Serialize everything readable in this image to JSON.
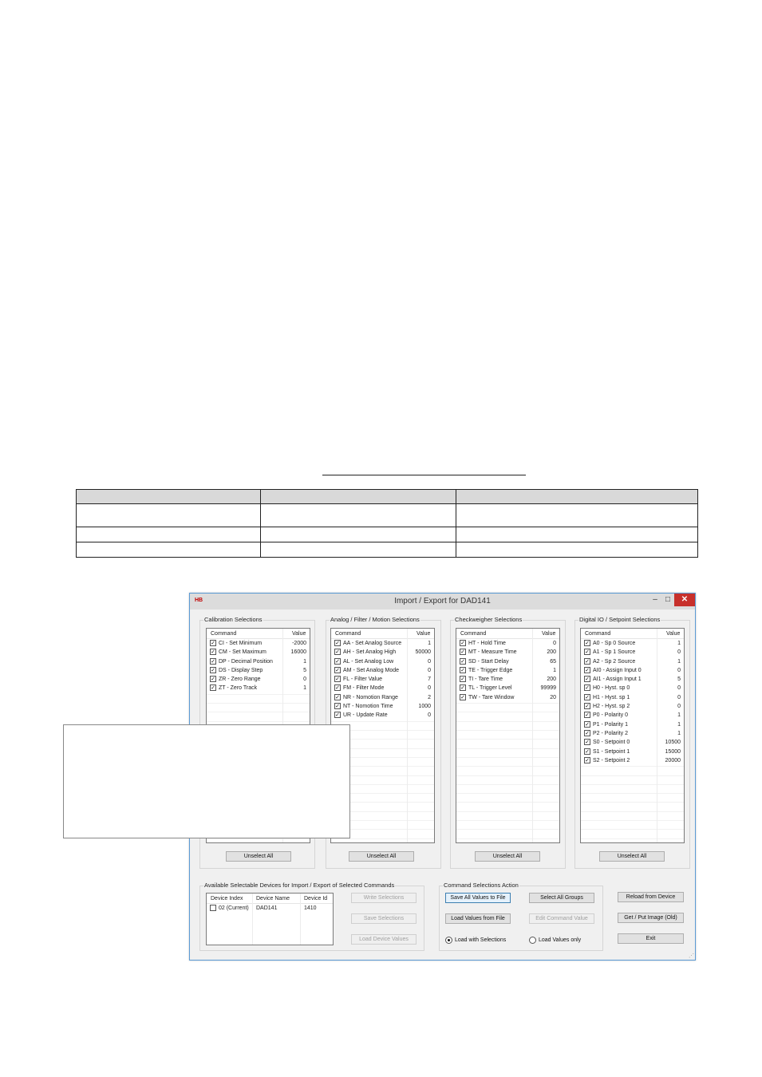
{
  "window": {
    "app_icon_text": "HB",
    "title": "Import / Export for DAD141",
    "minimize": "–",
    "maximize": "□",
    "close": "✕"
  },
  "columns": {
    "command": "Command",
    "value": "Value"
  },
  "calibration": {
    "title": "Calibration Selections",
    "rows": [
      {
        "cmd": "CI - Set Minimum",
        "val": "-2000"
      },
      {
        "cmd": "CM - Set Maximum",
        "val": "16000"
      },
      {
        "cmd": "DP - Decimal Position",
        "val": "1"
      },
      {
        "cmd": "DS - Display Step",
        "val": "5"
      },
      {
        "cmd": "ZR - Zero Range",
        "val": "0"
      },
      {
        "cmd": "ZT - Zero Track",
        "val": "1"
      }
    ],
    "unselect": "Unselect All"
  },
  "analog": {
    "title": "Analog / Filter / Motion Selections",
    "rows": [
      {
        "cmd": "AA - Set Analog Source",
        "val": "1"
      },
      {
        "cmd": "AH - Set Analog High",
        "val": "50000"
      },
      {
        "cmd": "AL - Set Analog Low",
        "val": "0"
      },
      {
        "cmd": "AM - Set Analog Mode",
        "val": "0"
      },
      {
        "cmd": "FL - Filter Value",
        "val": "7"
      },
      {
        "cmd": "FM - Filter Mode",
        "val": "0"
      },
      {
        "cmd": "NR - Nomotion Range",
        "val": "2"
      },
      {
        "cmd": "NT - Nomotion Time",
        "val": "1000"
      },
      {
        "cmd": "UR - Update Rate",
        "val": "0"
      }
    ],
    "unselect": "Unselect All"
  },
  "checkweigher": {
    "title": "Checkweigher Selections",
    "rows": [
      {
        "cmd": "HT - Hold Time",
        "val": "0"
      },
      {
        "cmd": "MT - Measure Time",
        "val": "200"
      },
      {
        "cmd": "SD - Start Delay",
        "val": "65"
      },
      {
        "cmd": "TE - Trigger Edge",
        "val": "1"
      },
      {
        "cmd": "TI - Tare Time",
        "val": "200"
      },
      {
        "cmd": "TL - Trigger Level",
        "val": "99999"
      },
      {
        "cmd": "TW - Tare Window",
        "val": "20"
      }
    ],
    "unselect": "Unselect All"
  },
  "digital": {
    "title": "Digital IO / Setpoint Selections",
    "rows": [
      {
        "cmd": "A0 - Sp 0 Source",
        "val": "1"
      },
      {
        "cmd": "A1 - Sp 1 Source",
        "val": "0"
      },
      {
        "cmd": "A2 - Sp 2 Source",
        "val": "1"
      },
      {
        "cmd": "AI0 - Assign Input 0",
        "val": "0"
      },
      {
        "cmd": "AI1 - Assign Input 1",
        "val": "5"
      },
      {
        "cmd": "H0 - Hyst. sp 0",
        "val": "0"
      },
      {
        "cmd": "H1 - Hyst. sp 1",
        "val": "0"
      },
      {
        "cmd": "H2 - Hyst. sp 2",
        "val": "0"
      },
      {
        "cmd": "P0 - Polarity 0",
        "val": "1"
      },
      {
        "cmd": "P1 - Polarity 1",
        "val": "1"
      },
      {
        "cmd": "P2 - Polarity 2",
        "val": "1"
      },
      {
        "cmd": "S0 - Setpoint 0",
        "val": "10500"
      },
      {
        "cmd": "S1 - Setpoint 1",
        "val": "15000"
      },
      {
        "cmd": "S2 - Setpoint 2",
        "val": "20000"
      }
    ],
    "unselect": "Unselect All"
  },
  "devices": {
    "title": "Available Selectable Devices for Import / Export of Selected Commands",
    "headers": {
      "index": "Device Index",
      "name": "Device Name",
      "id": "Device Id"
    },
    "rows": [
      {
        "index": "02 (Current)",
        "name": "DAD141",
        "id": "1410"
      }
    ],
    "write": "Write Selections",
    "save": "Save Selections",
    "load": "Load Device Values"
  },
  "actions": {
    "title": "Command Selections Action",
    "save_all": "Save All Values to File",
    "select_all": "Select All Groups",
    "load_file": "Load Values from File",
    "edit": "Edit Command Value",
    "radio_sel": "Load with Selections",
    "radio_only": "Load Values only"
  },
  "side": {
    "reload": "Reload from Device",
    "getput": "Get / Put Image (Old)",
    "exit": "Exit"
  }
}
